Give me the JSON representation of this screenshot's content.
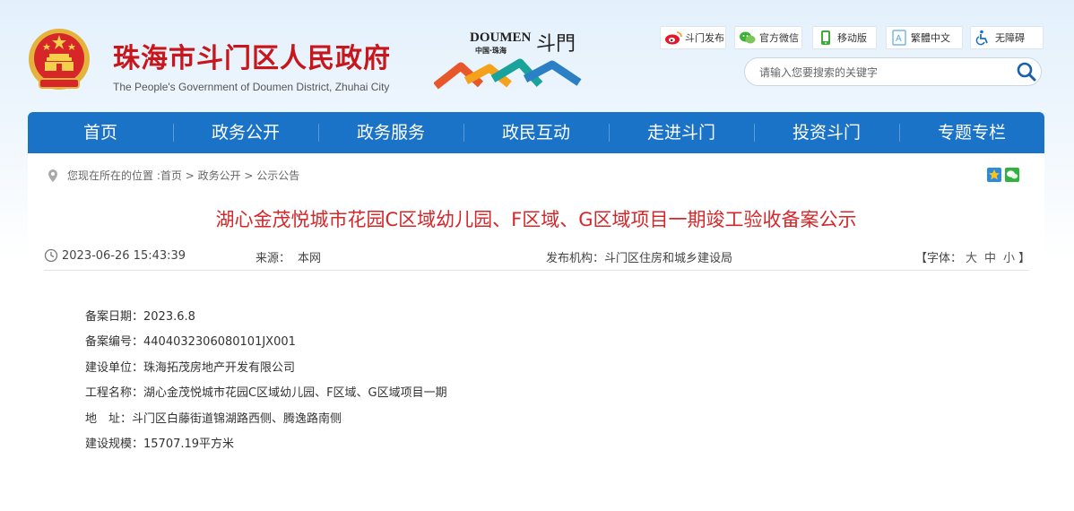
{
  "header": {
    "site_title": "珠海市斗门区人民政府",
    "site_subtitle": "The People's Government of Doumen District, Zhuhai City",
    "brand_logo": {
      "text_latin": "DOUMEN",
      "text_cn_small": "中国·珠海",
      "text_cn_large": "斗門",
      "colors": [
        "#e8572a",
        "#f4a21b",
        "#1aa39a",
        "#2b7fc4"
      ]
    },
    "top_links": [
      {
        "label": "斗门发布",
        "icon": "weibo-icon"
      },
      {
        "label": "官方微信",
        "icon": "wechat-icon"
      },
      {
        "label": "移动版",
        "icon": "mobile-icon"
      },
      {
        "label": "繁體中文",
        "icon": "traditional-chinese-icon"
      },
      {
        "label": "无障碍",
        "icon": "accessibility-icon"
      }
    ],
    "search": {
      "placeholder": "请输入您要搜索的关键字",
      "icon": "search-icon"
    }
  },
  "nav": {
    "items": [
      "首页",
      "政务公开",
      "政务服务",
      "政民互动",
      "走进斗门",
      "投资斗门",
      "专题专栏"
    ],
    "color": "#1a73c6"
  },
  "breadcrumb": {
    "prefix": "您现在所在的位置 : ",
    "items": [
      "首页",
      "政务公开",
      "公示公告"
    ],
    "separator": " > "
  },
  "share_icons": [
    "qzone-icon",
    "wechat-share-icon"
  ],
  "article": {
    "title": "湖心金茂悦城市花园C区域幼儿园、F区域、G区域项目一期竣工验收备案公示",
    "meta": {
      "datetime": "2023-06-26 15:43:39",
      "source_label": "来源：",
      "source_value": "本网",
      "publisher_label": "发布机构：",
      "publisher_value": "斗门区住房和城乡建设局",
      "font_label": "【字体：",
      "font_options": [
        "大",
        "中",
        "小"
      ],
      "font_close": "】"
    },
    "fields": [
      "备案日期：2023.6.8",
      "备案编号：4404032306080101JX001",
      "建设单位：珠海拓茂房地产开发有限公司",
      "工程名称：湖心金茂悦城市花园C区域幼儿园、F区域、G区域项目一期",
      "地　址：斗门区白藤街道锦湖路西侧、腾逸路南侧",
      "建设规模：15707.19平方米"
    ],
    "title_color": "#d3272a"
  }
}
